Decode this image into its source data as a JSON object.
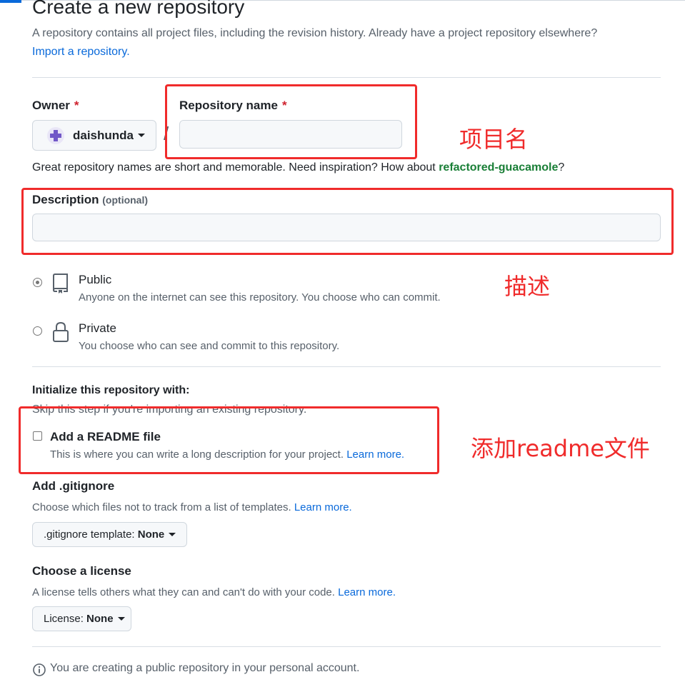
{
  "header": {
    "title": "Create a new repository",
    "intro": "A repository contains all project files, including the revision history. Already have a project repository elsewhere?",
    "import_link": "Import a repository."
  },
  "owner": {
    "label": "Owner",
    "required_mark": "*",
    "value": "daishunda",
    "separator": "/"
  },
  "repo_name": {
    "label": "Repository name",
    "required_mark": "*",
    "value": "",
    "hint_prefix": "Great repository names are short and memorable. Need inspiration? How about ",
    "suggestion": "refactored-guacamole",
    "hint_suffix": "?"
  },
  "description": {
    "label": "Description",
    "optional": "(optional)",
    "value": ""
  },
  "visibility": {
    "options": [
      {
        "label": "Public",
        "desc": "Anyone on the internet can see this repository. You choose who can commit.",
        "checked": true,
        "icon": "repo-icon"
      },
      {
        "label": "Private",
        "desc": "You choose who can see and commit to this repository.",
        "checked": false,
        "icon": "lock-icon"
      }
    ]
  },
  "initialize": {
    "title": "Initialize this repository with:",
    "skip_text": "Skip this step if you're importing an existing repository.",
    "readme_label": "Add a README file",
    "readme_desc": "This is where you can write a long description for your project.",
    "learn_more": "Learn more."
  },
  "gitignore": {
    "title": "Add .gitignore",
    "desc": "Choose which files not to track from a list of templates.",
    "learn_more": "Learn more.",
    "select_prefix": ".gitignore template:",
    "select_value": "None"
  },
  "license": {
    "title": "Choose a license",
    "desc": "A license tells others what they can and can't do with your code.",
    "learn_more": "Learn more.",
    "select_prefix": "License:",
    "select_value": "None"
  },
  "footer": {
    "notice": "You are creating a public repository in your personal account."
  },
  "annotations": {
    "repo_name": "项目名",
    "description": "描述",
    "readme": "添加readme文件"
  },
  "colors": {
    "link": "#0969da",
    "suggestion": "#1a7f37",
    "required": "#cf222e",
    "annotation": "#f02b2b"
  }
}
